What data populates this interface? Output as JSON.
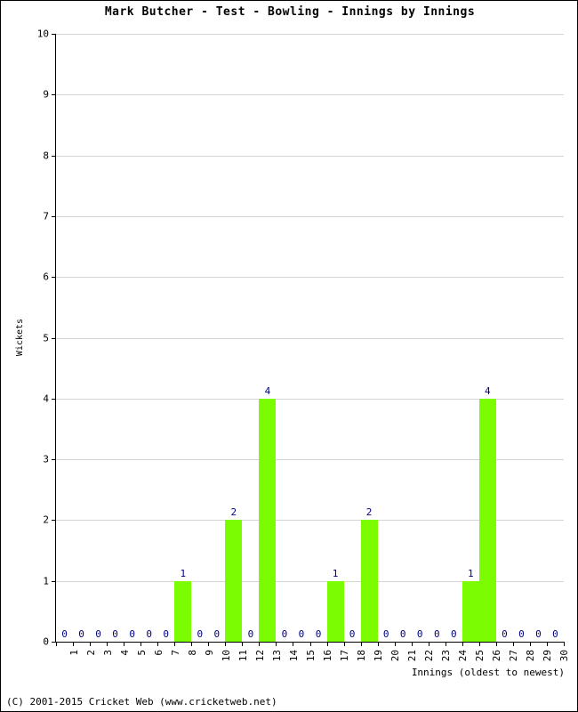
{
  "chart_data": {
    "type": "bar",
    "title": "Mark Butcher - Test - Bowling - Innings by Innings",
    "xlabel": "Innings (oldest to newest)",
    "ylabel": "Wickets",
    "ylim": [
      0,
      10
    ],
    "ytick_labels": [
      "0",
      "1",
      "2",
      "3",
      "4",
      "5",
      "6",
      "7",
      "8",
      "9",
      "10"
    ],
    "ytick_values": [
      0,
      1,
      2,
      3,
      4,
      5,
      6,
      7,
      8,
      9,
      10
    ],
    "grid": true,
    "legend": false,
    "bar_color": "#7CFC00",
    "value_label_color": "#000080",
    "categories": [
      "1",
      "2",
      "3",
      "4",
      "5",
      "6",
      "7",
      "8",
      "9",
      "10",
      "11",
      "12",
      "13",
      "14",
      "15",
      "16",
      "17",
      "18",
      "19",
      "20",
      "21",
      "22",
      "23",
      "24",
      "25",
      "26",
      "27",
      "28",
      "29",
      "30"
    ],
    "values": [
      0,
      0,
      0,
      0,
      0,
      0,
      0,
      1,
      0,
      0,
      2,
      0,
      4,
      0,
      0,
      0,
      1,
      0,
      2,
      0,
      0,
      0,
      0,
      0,
      1,
      4,
      0,
      0,
      0,
      0
    ],
    "value_labels": [
      "0",
      "0",
      "0",
      "0",
      "0",
      "0",
      "0",
      "1",
      "0",
      "0",
      "2",
      "0",
      "4",
      "0",
      "0",
      "0",
      "1",
      "0",
      "2",
      "0",
      "0",
      "0",
      "0",
      "0",
      "1",
      "4",
      "0",
      "0",
      "0",
      "0"
    ]
  },
  "footer": {
    "copyright": "(C) 2001-2015 Cricket Web (www.cricketweb.net)"
  }
}
